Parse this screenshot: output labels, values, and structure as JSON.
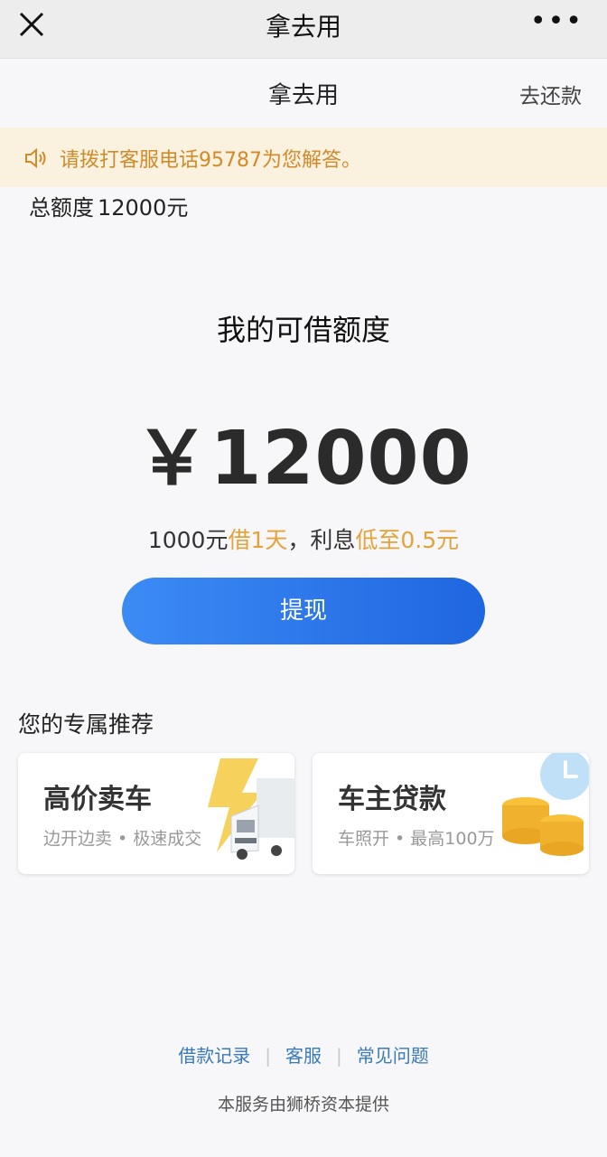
{
  "topbar": {
    "title": "拿去用",
    "close_icon": "close-icon",
    "more_label": "•••"
  },
  "header": {
    "title": "拿去用",
    "repay_label": "去还款"
  },
  "notice": {
    "text": "请拨打客服电话95787为您解答。",
    "color": "#d08a2a"
  },
  "credit": {
    "total_label": "总额度",
    "total_value": "12000元",
    "available_label": "我的可借额度",
    "available_amount": "￥12000",
    "rate": {
      "prefix": "1000元",
      "hl1": "借1天",
      "mid": "，利息",
      "hl2": "低至0.5元"
    }
  },
  "withdraw_label": "提现",
  "accent": "#2d79ec",
  "recommend": {
    "title": "您的专属推荐",
    "cards": [
      {
        "title": "高价卖车",
        "subtitle": "边开边卖 • 极速成交",
        "icon": "truck-icon"
      },
      {
        "title": "车主贷款",
        "subtitle": "车照开 • 最高100万",
        "icon": "coins-icon"
      }
    ]
  },
  "links": [
    "借款记录",
    "客服",
    "常见问题"
  ],
  "footer": "本服务由狮桥资本提供"
}
